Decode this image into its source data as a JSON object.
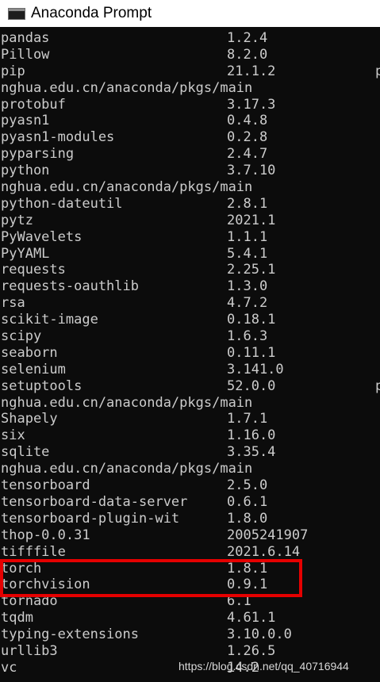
{
  "window": {
    "title": "Anaconda Prompt"
  },
  "console": {
    "rows": [
      {
        "pkg": "pandas",
        "ver": "1.2.4",
        "extra": ""
      },
      {
        "pkg": "Pillow",
        "ver": "8.2.0",
        "extra": ""
      },
      {
        "pkg": "pip",
        "ver": "21.1.2",
        "extra": "p"
      },
      {
        "pkg": "nghua.edu.cn/anaconda/pkgs/main",
        "ver": "",
        "extra": ""
      },
      {
        "pkg": "protobuf",
        "ver": "3.17.3",
        "extra": ""
      },
      {
        "pkg": "pyasn1",
        "ver": "0.4.8",
        "extra": ""
      },
      {
        "pkg": "pyasn1-modules",
        "ver": "0.2.8",
        "extra": ""
      },
      {
        "pkg": "pyparsing",
        "ver": "2.4.7",
        "extra": ""
      },
      {
        "pkg": "python",
        "ver": "3.7.10",
        "extra": ""
      },
      {
        "pkg": "nghua.edu.cn/anaconda/pkgs/main",
        "ver": "",
        "extra": ""
      },
      {
        "pkg": "python-dateutil",
        "ver": "2.8.1",
        "extra": ""
      },
      {
        "pkg": "pytz",
        "ver": "2021.1",
        "extra": ""
      },
      {
        "pkg": "PyWavelets",
        "ver": "1.1.1",
        "extra": ""
      },
      {
        "pkg": "PyYAML",
        "ver": "5.4.1",
        "extra": ""
      },
      {
        "pkg": "requests",
        "ver": "2.25.1",
        "extra": ""
      },
      {
        "pkg": "requests-oauthlib",
        "ver": "1.3.0",
        "extra": ""
      },
      {
        "pkg": "rsa",
        "ver": "4.7.2",
        "extra": ""
      },
      {
        "pkg": "scikit-image",
        "ver": "0.18.1",
        "extra": ""
      },
      {
        "pkg": "scipy",
        "ver": "1.6.3",
        "extra": ""
      },
      {
        "pkg": "seaborn",
        "ver": "0.11.1",
        "extra": ""
      },
      {
        "pkg": "selenium",
        "ver": "3.141.0",
        "extra": ""
      },
      {
        "pkg": "setuptools",
        "ver": "52.0.0",
        "extra": "p"
      },
      {
        "pkg": "nghua.edu.cn/anaconda/pkgs/main",
        "ver": "",
        "extra": ""
      },
      {
        "pkg": "Shapely",
        "ver": "1.7.1",
        "extra": ""
      },
      {
        "pkg": "six",
        "ver": "1.16.0",
        "extra": ""
      },
      {
        "pkg": "sqlite",
        "ver": "3.35.4",
        "extra": ""
      },
      {
        "pkg": "nghua.edu.cn/anaconda/pkgs/main",
        "ver": "",
        "extra": ""
      },
      {
        "pkg": "tensorboard",
        "ver": "2.5.0",
        "extra": ""
      },
      {
        "pkg": "tensorboard-data-server",
        "ver": "0.6.1",
        "extra": ""
      },
      {
        "pkg": "tensorboard-plugin-wit",
        "ver": "1.8.0",
        "extra": ""
      },
      {
        "pkg": "thop-0.0.31",
        "ver": "2005241907",
        "extra": ""
      },
      {
        "pkg": "tifffile",
        "ver": "2021.6.14",
        "extra": ""
      },
      {
        "pkg": "torch",
        "ver": "1.8.1",
        "extra": ""
      },
      {
        "pkg": "torchvision",
        "ver": "0.9.1",
        "extra": ""
      },
      {
        "pkg": "tornado",
        "ver": "6.1",
        "extra": ""
      },
      {
        "pkg": "tqdm",
        "ver": "4.61.1",
        "extra": ""
      },
      {
        "pkg": "typing-extensions",
        "ver": "3.10.0.0",
        "extra": ""
      },
      {
        "pkg": "urllib3",
        "ver": "1.26.5",
        "extra": ""
      },
      {
        "pkg": "vc",
        "ver": "14.2",
        "extra": ""
      }
    ]
  },
  "watermark": {
    "text": "https://blog.csdn.net/qq_40716944"
  },
  "colors": {
    "terminal_bg": "#0c0c0c",
    "terminal_fg": "#cccccc",
    "highlight_border": "#e50000",
    "titlebar_bg": "#ffffff"
  },
  "icons": {
    "app_icon": "console-window-icon"
  }
}
